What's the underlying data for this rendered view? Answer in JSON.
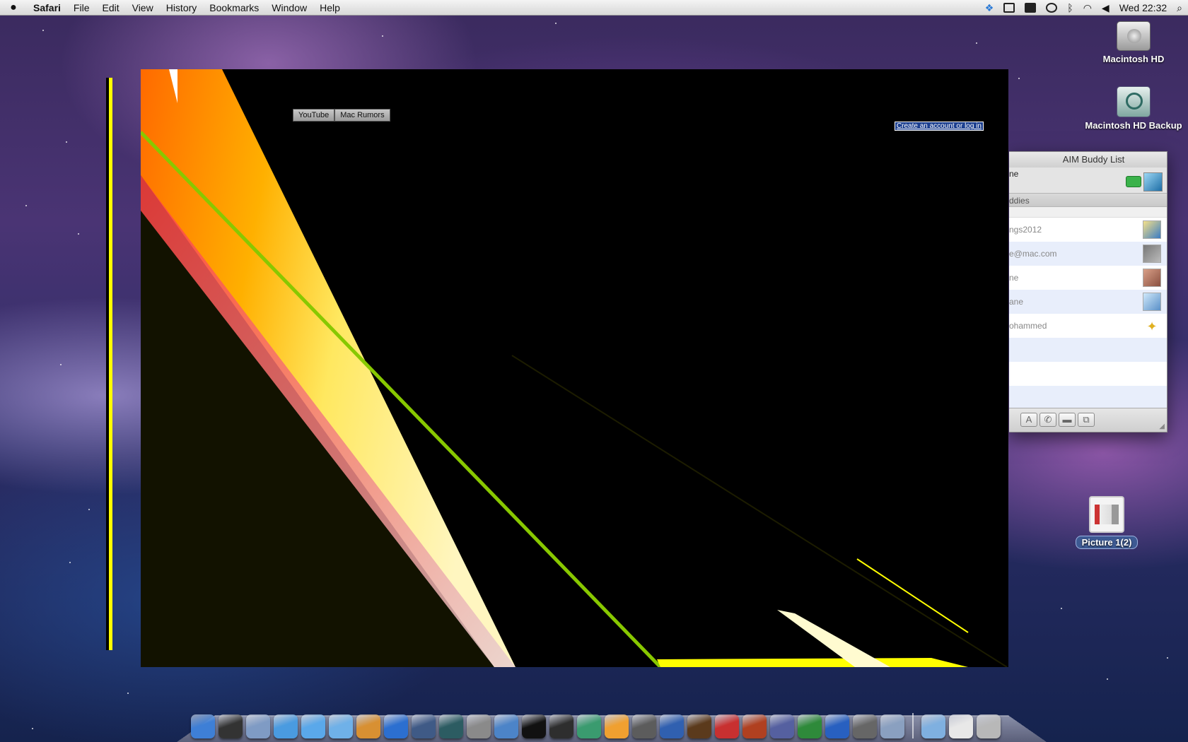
{
  "menubar": {
    "app": "Safari",
    "menus": [
      "File",
      "Edit",
      "View",
      "History",
      "Bookmarks",
      "Window",
      "Help"
    ],
    "clock": "Wed 22:32",
    "tray_icons": [
      "dropbox-icon",
      "display-icon",
      "spaces-icon",
      "time-machine-icon",
      "bluetooth-icon",
      "wifi-icon",
      "volume-icon",
      "spotlight-icon"
    ]
  },
  "desktop": {
    "icons": [
      {
        "label": "Macintosh HD",
        "icon": "hard-drive-icon"
      },
      {
        "label": "Macintosh HD Backup",
        "icon": "time-machine-drive-icon"
      },
      {
        "label": "Picture 1(2)",
        "icon": "screenshot-file-icon"
      }
    ]
  },
  "browser": {
    "bookmarks": [
      "YouTube",
      "Mac Rumors"
    ],
    "login_link": "Create an account or log in"
  },
  "aim": {
    "title": "AIM Buddy List",
    "my_name_partial": "ne",
    "group_label": "ddies",
    "buddies": [
      {
        "name": "ngs2012",
        "avatar": "globe-avatar"
      },
      {
        "name": "e@mac.com",
        "avatar": "person-avatar"
      },
      {
        "name": "ne",
        "avatar": "face-avatar"
      },
      {
        "name": "ane",
        "avatar": "snowflake-avatar"
      },
      {
        "name": "ohammed",
        "avatar": "aim-running-man-avatar"
      }
    ],
    "toolbar": [
      {
        "label": "A",
        "icon": "text-chat-icon"
      },
      {
        "label": "✆",
        "icon": "audio-chat-icon"
      },
      {
        "label": "▬",
        "icon": "video-chat-icon"
      },
      {
        "label": "⧉",
        "icon": "screen-share-icon"
      }
    ]
  },
  "dock": {
    "apps": [
      {
        "name": "finder-icon",
        "color": "#3e7fd6"
      },
      {
        "name": "dashboard-icon",
        "color": "#333333"
      },
      {
        "name": "mail-icon",
        "color": "#7f9bc4"
      },
      {
        "name": "safari-icon",
        "color": "#4a9be0"
      },
      {
        "name": "ichat-icon",
        "color": "#5aa8ea"
      },
      {
        "name": "itunes-icon",
        "color": "#6fb1e8"
      },
      {
        "name": "iphoto-icon",
        "color": "#d89032"
      },
      {
        "name": "dvd-player-icon",
        "color": "#2c6fd0"
      },
      {
        "name": "spaces-icon",
        "color": "#3f5a86"
      },
      {
        "name": "time-machine-icon",
        "color": "#2c5c62"
      },
      {
        "name": "system-preferences-icon",
        "color": "#8a8a8a"
      },
      {
        "name": "xcode-icon",
        "color": "#4c84c8"
      },
      {
        "name": "terminal-icon",
        "color": "#111111"
      },
      {
        "name": "aperture-icon",
        "color": "#2e2e2e"
      },
      {
        "name": "quill-app-icon",
        "color": "#3a9b6f"
      },
      {
        "name": "flower-app-icon",
        "color": "#f0a030"
      },
      {
        "name": "imovie-icon",
        "color": "#5c5c5c"
      },
      {
        "name": "text-app-icon",
        "color": "#3060b0"
      },
      {
        "name": "garageband-icon",
        "color": "#5b3a1c"
      },
      {
        "name": "parallels-icon",
        "color": "#c83030"
      },
      {
        "name": "keynote-icon",
        "color": "#b04020"
      },
      {
        "name": "brush-app-icon",
        "color": "#5560a0"
      },
      {
        "name": "numbers-icon",
        "color": "#2e8a3a"
      },
      {
        "name": "home-app-icon",
        "color": "#2860c0"
      },
      {
        "name": "printer-icon",
        "color": "#666666"
      },
      {
        "name": "preview-icon",
        "color": "#8aa0c0"
      }
    ],
    "stacks": [
      {
        "name": "applications-folder-icon",
        "color": "#7fb0e0"
      },
      {
        "name": "documents-stack-icon",
        "color": "#e8e8e8"
      },
      {
        "name": "trash-icon",
        "color": "#b8b8b8"
      }
    ]
  }
}
